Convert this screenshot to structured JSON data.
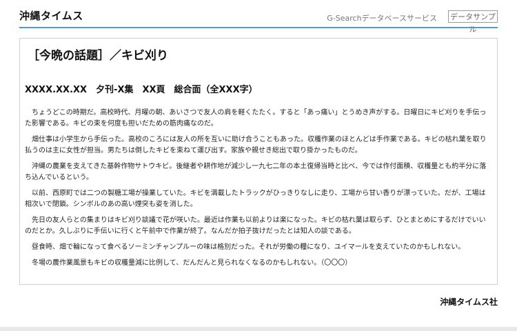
{
  "header": {
    "brand": "沖縄タイムス",
    "service": "G-Searchデータベースサービス",
    "sample_badge": "データサンプル"
  },
  "article": {
    "headline": "［今晩の話題］／キビ刈り",
    "meta": "XXXX.XX.XX　夕刊-X集　XX頁　総合面（全XXX字）",
    "paragraphs": [
      "ちょうどこの時期だ。高校時代、月曜の朝、あいさつで友人の肩を軽くたたく。すると「あっ痛い」とうめき声がする。日曜日にキビ刈りを手伝った影響である。キビの束を何度も担いだための筋肉痛なのだ。",
      "畑仕事は小学生から手伝った。高校のころには友人の所を互いに助け合うこともあった。収穫作業のほとんどは手作業である。キビの枯れ葉を取り払うのは主に女性が担当。男たちは倒したキビを束ねて運び出す。家族や親せき総出で取り掛かったものだ。",
      "沖縄の農業を支えてきた基幹作物サトウキビ。後継者や耕作地が減少し一九七二年の本土復帰当時と比べ、今では作付面積、収穫量とも約半分に落ち込んでいるという。",
      "以前、西原町では二つの製糖工場が操業していた。キビを満載したトラックがひっきりなしに走り、工場から甘い香りが漂っていた。だが、工場は相次いで閉鎖。シンボルのあの高い煙突も姿を消した。",
      "先日の友人らとの集まりはキビ刈り談議で花が咲いた。最近は作業も以前よりは楽になった。キビの枯れ葉は取らず、ひとまとめにするだけでいいのだとか。久しぶりに手伝いに行くと午前中で作業が終了。なんだか拍子抜けだったとは知人の談である。",
      "昼食時、畑で輪になって食べるソーミンチャンプルーの味は格別だった。それが労働の糧になり、ユイマールを支えていたのかもしれない。",
      "冬場の農作業風景もキビの収穫量減に比例して、だんだんと見られなくなるのかもしれない。（〇〇〇）"
    ]
  },
  "footer": {
    "publisher": "沖縄タイムス社"
  }
}
